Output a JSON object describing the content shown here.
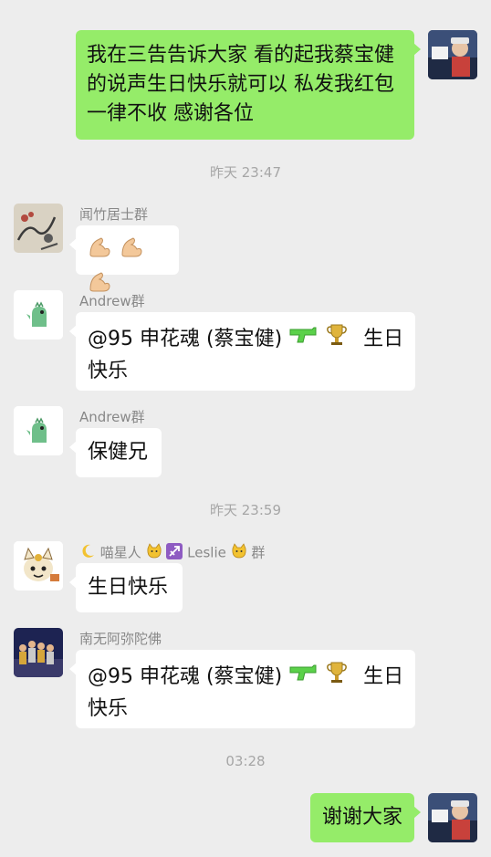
{
  "chat": {
    "messages": [
      {
        "type": "outgoing",
        "text": "我在三告告诉大家 看的起我蔡宝健的说声生日快乐就可以 私发我红包一律不收 感谢各位"
      },
      {
        "type": "time",
        "text": "昨天 23:47"
      },
      {
        "type": "incoming",
        "sender": "闻竹居士群",
        "content": "emoji",
        "emoji_icons": [
          "flexed-biceps-icon",
          "flexed-biceps-icon",
          "flexed-biceps-icon"
        ]
      },
      {
        "type": "incoming",
        "sender": "Andrew群",
        "text_a": "@95 申花魂 (蔡宝健)",
        "emoji_icons": [
          "water-pistol-icon",
          "trophy-icon"
        ],
        "text_b": "生日",
        "text_c": "快乐"
      },
      {
        "type": "incoming",
        "sender": "Andrew群",
        "text": "保健兄"
      },
      {
        "type": "time",
        "text": "昨天 23:59"
      },
      {
        "type": "incoming",
        "sender_parts": [
          "喵星人",
          "Leslie",
          "群"
        ],
        "sender_emoji_icons": [
          "crescent-moon-icon",
          "cat-face-icon",
          "sagittarius-icon",
          "cat-face-icon"
        ],
        "text": "生日快乐"
      },
      {
        "type": "incoming",
        "sender": "南无阿弥陀佛",
        "text_a": "@95 申花魂 (蔡宝健)",
        "emoji_icons": [
          "water-pistol-icon",
          "trophy-icon"
        ],
        "text_b": "生日",
        "text_c": "快乐"
      },
      {
        "type": "time",
        "text": "03:28"
      },
      {
        "type": "outgoing",
        "text": "谢谢大家"
      }
    ]
  },
  "colors": {
    "background": "#ededed",
    "outgoing_bubble": "#95ec69",
    "incoming_bubble": "#ffffff",
    "sender_text": "#888888",
    "time_text": "#a6a6a6"
  }
}
